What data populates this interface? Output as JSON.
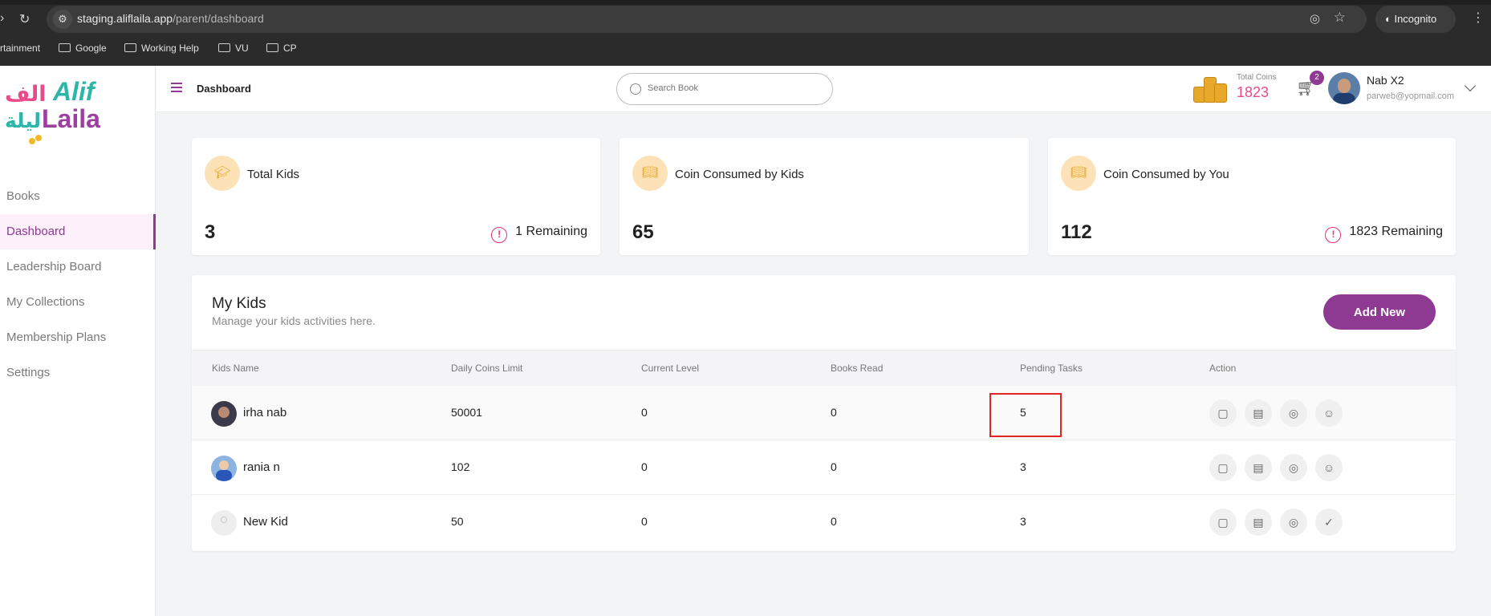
{
  "browser": {
    "url_host": "staging.aliflaila.app",
    "url_path": "/parent/dashboard",
    "incognito_label": "Incognito",
    "bookmarks": [
      "rtainment",
      "Google",
      "Working Help",
      "VU",
      "CP"
    ]
  },
  "logo": {
    "text_top": "Alif",
    "text_bottom": "Laila",
    "arabic_top": "الف",
    "arabic_bottom": "ليلة"
  },
  "sidebar": {
    "items": [
      {
        "label": "Books",
        "active": false
      },
      {
        "label": "Dashboard",
        "active": true
      },
      {
        "label": "Leadership Board",
        "active": false
      },
      {
        "label": "My Collections",
        "active": false
      },
      {
        "label": "Membership Plans",
        "active": false
      },
      {
        "label": "Settings",
        "active": false
      }
    ]
  },
  "topbar": {
    "breadcrumb": "Dashboard",
    "search_placeholder": "Search Book",
    "coins_label": "Total Coins",
    "coins_value": "1823",
    "cart_count": "2",
    "user_name": "Nab X2",
    "user_email": "parweb@yopmail.com"
  },
  "stats": [
    {
      "title": "Total Kids",
      "value": "3",
      "remaining": "1 Remaining",
      "icon": "graduation-cap-icon"
    },
    {
      "title": "Coin Consumed by Kids",
      "value": "65",
      "remaining": "",
      "icon": "book-icon"
    },
    {
      "title": "Coin Consumed by You",
      "value": "112",
      "remaining": "1823 Remaining",
      "icon": "book-icon"
    }
  ],
  "kids": {
    "title": "My Kids",
    "subtitle": "Manage your kids activities here.",
    "add_label": "Add New",
    "columns": [
      "Kids Name",
      "Daily Coins Limit",
      "Current Level",
      "Books Read",
      "Pending Tasks",
      "Action"
    ],
    "rows": [
      {
        "name": "irha nab",
        "daily_limit": "50001",
        "level": "0",
        "books_read": "0",
        "pending": "5"
      },
      {
        "name": "rania n",
        "daily_limit": "102",
        "level": "0",
        "books_read": "0",
        "pending": "3"
      },
      {
        "name": "New Kid",
        "daily_limit": "50",
        "level": "0",
        "books_read": "0",
        "pending": "3"
      }
    ]
  },
  "colors": {
    "accent": "#8e3a93",
    "coins": "#e84a8a",
    "warning": "#e8336a",
    "highlight": "#e02424"
  }
}
